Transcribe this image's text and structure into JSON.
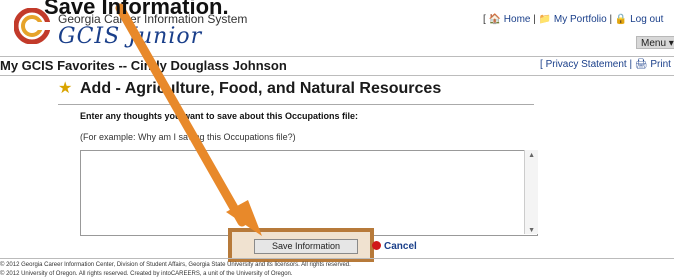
{
  "header": {
    "system_name": "Georgia Career Information System",
    "product_name": "GCIS Junior",
    "links": {
      "home": "Home",
      "portfolio": "My Portfolio",
      "logout": "Log out"
    },
    "menu_label": "Menu ▾"
  },
  "favorites_bar": {
    "title": "My GCIS Favorites -- Cindy Douglass Johnson",
    "privacy": "Privacy Statement",
    "print": "Print"
  },
  "main": {
    "heading": "Add - Agriculture, Food, and Natural Resources",
    "prompt": "Enter any thoughts you want to save about this Occupations file:",
    "example": "(For example: Why am I saving this Occupations file?)",
    "textarea_value": "",
    "save_label": "Save Information",
    "cancel_label": "Cancel"
  },
  "footer": {
    "line1": "© 2012 Georgia Career Information Center, Division of Student Affairs, Georgia State University and its licensors. All rights reserved.",
    "line2": "© 2012 University of Oregon. All rights reserved. Created by intoCAREERS, a unit of the University of Oregon."
  },
  "overlay": {
    "text": "Save Information."
  },
  "colors": {
    "link": "#1a3f8a",
    "highlight_frame": "#b77a3a",
    "arrow": "#e8892a"
  }
}
